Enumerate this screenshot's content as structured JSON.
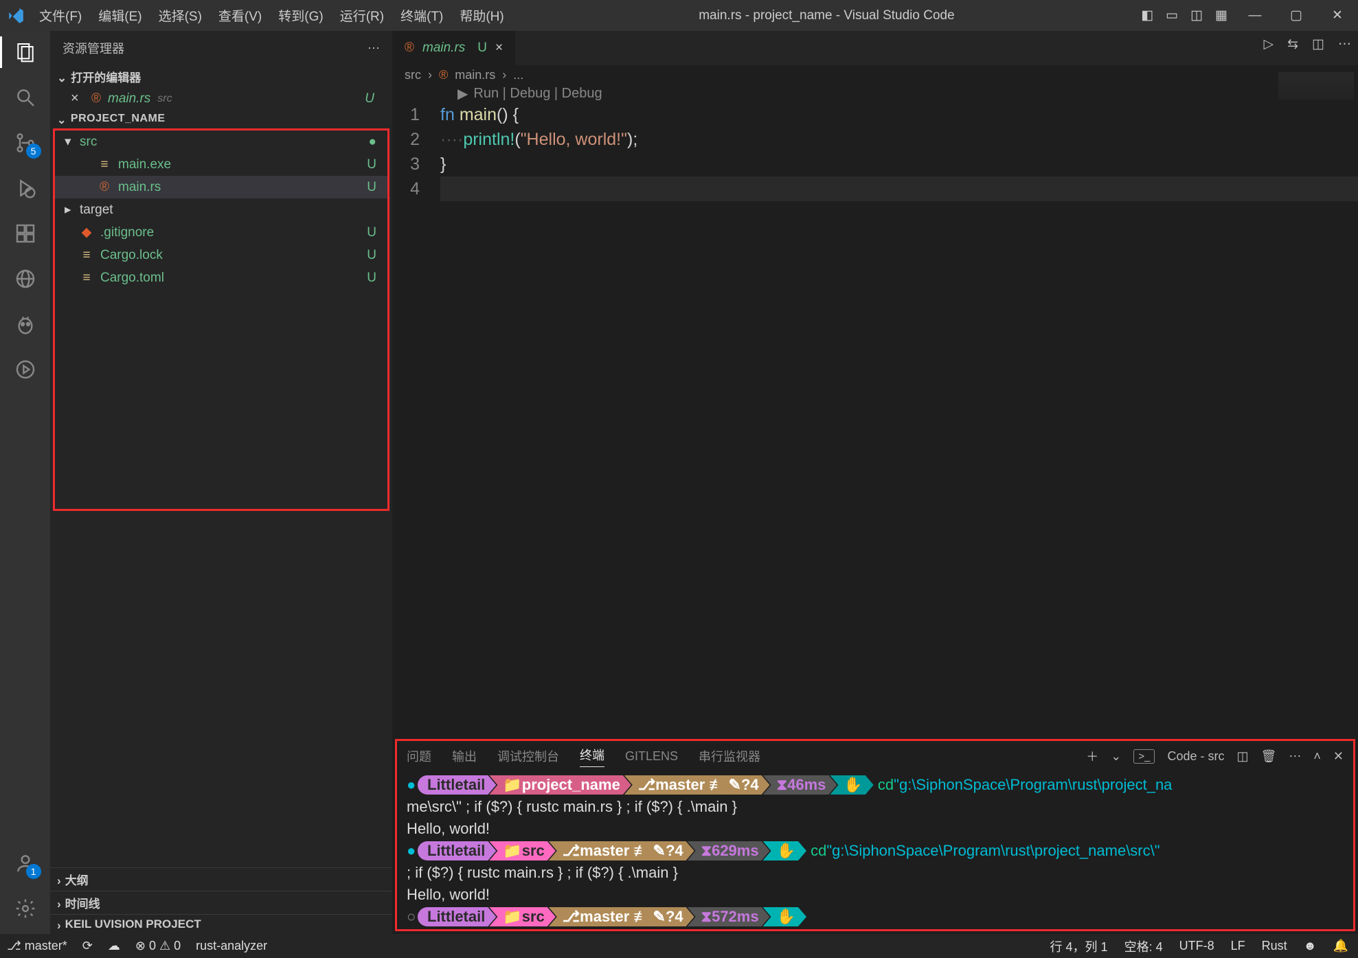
{
  "titlebar": {
    "menu": [
      "文件(F)",
      "编辑(E)",
      "选择(S)",
      "查看(V)",
      "转到(G)",
      "运行(R)",
      "终端(T)",
      "帮助(H)"
    ],
    "title": "main.rs - project_name - Visual Studio Code"
  },
  "activitybar": {
    "scm_badge": "5",
    "accounts_badge": "1"
  },
  "sidebar": {
    "title": "资源管理器",
    "open_editors_label": "打开的编辑器",
    "open_file": {
      "name": "main.rs",
      "folder": "src",
      "status": "U"
    },
    "project_label": "PROJECT_NAME",
    "tree": [
      {
        "kind": "folder",
        "open": true,
        "name": "src",
        "status": "●",
        "cls": "green",
        "indent": 0
      },
      {
        "kind": "file",
        "name": "main.exe",
        "status": "U",
        "cls": "green",
        "icon": "≡",
        "iconCls": "yellow",
        "indent": 1
      },
      {
        "kind": "file",
        "name": "main.rs",
        "status": "U",
        "cls": "green",
        "icon": "®",
        "iconCls": "rust-orange",
        "indent": 1,
        "selected": true
      },
      {
        "kind": "folder",
        "open": false,
        "name": "target",
        "status": "",
        "cls": "",
        "indent": 0
      },
      {
        "kind": "file",
        "name": ".gitignore",
        "status": "U",
        "cls": "green",
        "icon": "◆",
        "iconCls": "git-orange",
        "indent": 0
      },
      {
        "kind": "file",
        "name": "Cargo.lock",
        "status": "U",
        "cls": "green",
        "icon": "≡",
        "iconCls": "yellow",
        "indent": 0
      },
      {
        "kind": "file",
        "name": "Cargo.toml",
        "status": "U",
        "cls": "green",
        "icon": "≡",
        "iconCls": "yellow",
        "indent": 0
      }
    ],
    "outline": "大纲",
    "timeline": "时间线",
    "keil": "KEIL UVISION PROJECT"
  },
  "tab": {
    "name": "main.rs",
    "status": "U"
  },
  "breadcrumb": {
    "a": "src",
    "b": "main.rs",
    "c": "..."
  },
  "codelens": "Run | Debug | Debug",
  "code": {
    "l1": {
      "kw": "fn",
      "fn": "main",
      "rest": "() {"
    },
    "l2": {
      "dots": "····",
      "mac": "println!",
      "str": "\"Hello, world!\"",
      "rest": "(",
      "rest2": ");"
    },
    "l3": "}",
    "l4": ""
  },
  "panel": {
    "tabs": [
      "问题",
      "输出",
      "调试控制台",
      "终端",
      "GITLENS",
      "串行监视器"
    ],
    "active_index": 3,
    "right_label": "Code - src"
  },
  "terminal": {
    "user": "Littletail",
    "proj": "project_name",
    "src": "src",
    "branch1": "⎇master ≢ ✎?4",
    "branch2": "⎇master ≢ ✎?4",
    "branch3": "⎇master ≢ ✎?4",
    "t1": "⧗46ms",
    "t2": "⧗629ms",
    "t3": "⧗572ms",
    "cmd1a": "cd ",
    "path1": "\"g:\\SiphonSpace\\Program\\rust\\project_na",
    "wrap1": "me\\src\\\" ; if ($?) { rustc main.rs } ; if ($?) { .\\main }",
    "out1": "Hello, world!",
    "cmd2a": "cd ",
    "path2": "\"g:\\SiphonSpace\\Program\\rust\\project_name\\src\\\"",
    "wrap2": " ; if ($?) { rustc main.rs } ; if ($?) { .\\main }",
    "out2": "Hello, world!"
  },
  "statusbar": {
    "branch": "master*",
    "errors": "0",
    "warnings": "0",
    "analyzer": "rust-analyzer",
    "pos": "行 4，列 1",
    "spaces": "空格: 4",
    "enc": "UTF-8",
    "eol": "LF",
    "lang": "Rust",
    "bell": "🔔"
  }
}
